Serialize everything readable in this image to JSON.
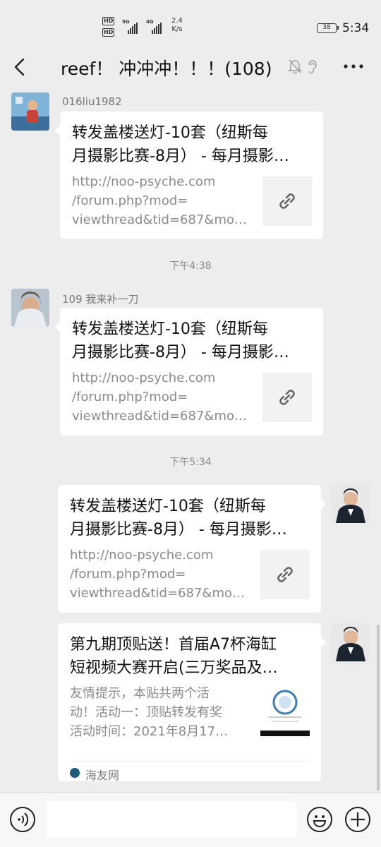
{
  "status_bar": {
    "hd1": "HD",
    "hd2": "HD",
    "net1": "5G",
    "net2": "4G",
    "speed_value": "2.4",
    "speed_unit": "K/s",
    "battery": "38",
    "time": "5:34"
  },
  "header": {
    "title": "reef！ 冲冲冲！！！(108)"
  },
  "messages": [
    {
      "sender": "016liu1982",
      "title_lines": [
        "转发盖楼送灯-10套（纽斯每",
        "月摄影比赛-8月） - 每月摄影…"
      ],
      "desc_lines": [
        "http://noo-psyche.com",
        "/forum.php?mod=",
        "viewthread&tid=687&mo…"
      ]
    },
    {
      "timestamp": "下午4:38",
      "sender": "109 我来补一刀",
      "title_lines": [
        "转发盖楼送灯-10套（纽斯每",
        "月摄影比赛-8月） - 每月摄影…"
      ],
      "desc_lines": [
        "http://noo-psyche.com",
        "/forum.php?mod=",
        "viewthread&tid=687&mo…"
      ]
    },
    {
      "timestamp": "下午5:34",
      "title_lines": [
        "转发盖楼送灯-10套（纽斯每",
        "月摄影比赛-8月） - 每月摄影…"
      ],
      "desc_lines": [
        "http://noo-psyche.com",
        "/forum.php?mod=",
        "viewthread&tid=687&mo…"
      ]
    },
    {
      "title_lines": [
        "第九期顶贴送！首届A7杯海缸",
        "短视频大赛开启(三万奖品及…"
      ],
      "desc_lines": [
        "友情提示，本贴共两个活",
        "动！活动一：顶贴转发有奖",
        "活动时间：2021年8月17…"
      ],
      "source": "海友网"
    }
  ],
  "icons": {
    "back": "chevron-left-icon",
    "mute": "bell-off-icon",
    "ear": "ear-icon",
    "more": "more-dots-icon",
    "link": "link-icon",
    "voice": "voice-icon",
    "emoji": "emoji-icon",
    "plus": "plus-icon"
  },
  "colors": {
    "background": "#ededed",
    "bubble": "#ffffff",
    "source_logo": "#1d5a7c"
  }
}
